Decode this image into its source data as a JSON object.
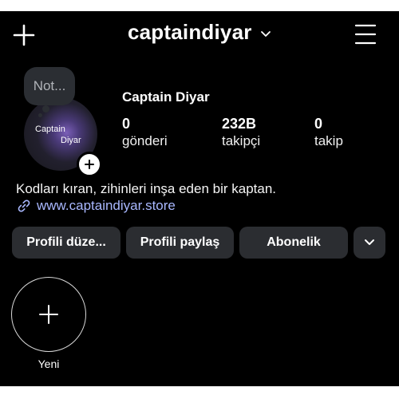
{
  "header": {
    "username": "captaindiyar"
  },
  "profile": {
    "note_text": "Not...",
    "avatar_text_line1": "Captain",
    "avatar_text_line2": "Diyar",
    "display_name": "Captain Diyar",
    "stats": [
      {
        "count": "0",
        "label": "gönderi"
      },
      {
        "count": "232B",
        "label": "takipçi"
      },
      {
        "count": "0",
        "label": "takip"
      }
    ],
    "bio": "Kodları kıran, zihinleri inşa eden bir kaptan.",
    "link": "www.captaindiyar.store"
  },
  "actions": {
    "edit_profile": "Profili düze...",
    "share_profile": "Profili paylaş",
    "subscription": "Abonelik"
  },
  "highlights": {
    "new_label": "Yeni"
  },
  "icons": [
    "plus-icon",
    "chevron-down-icon",
    "hamburger-menu-icon",
    "link-icon",
    "add-story-icon"
  ],
  "colors": {
    "background": "#000000",
    "button": "#2b2d31",
    "link": "#a9b8ff"
  }
}
